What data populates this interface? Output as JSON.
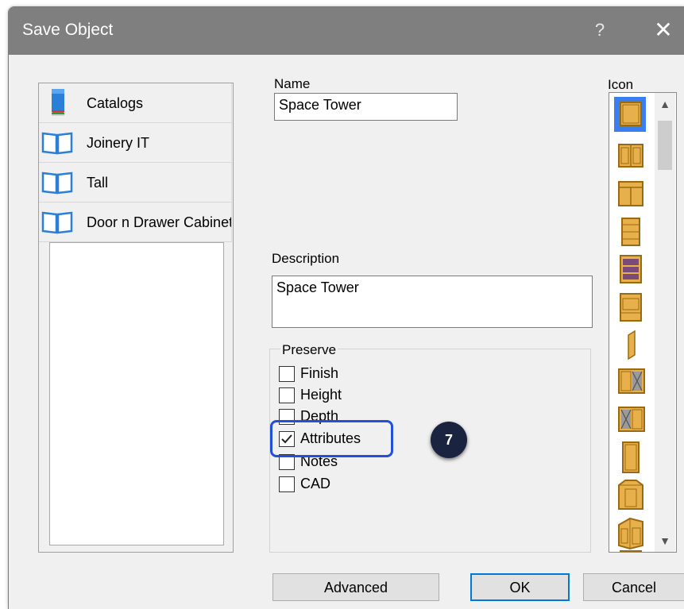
{
  "window": {
    "title": "Save Object",
    "help_label": "?",
    "close_label": "✕"
  },
  "catalog_tree": {
    "items": [
      {
        "label": "Catalogs",
        "icon": "catalog-book-icon"
      },
      {
        "label": "Joinery IT",
        "icon": "open-book-icon"
      },
      {
        "label": "Tall",
        "icon": "open-book-icon"
      },
      {
        "label": "Door n Drawer Cabinet",
        "icon": "open-book-icon"
      }
    ]
  },
  "form": {
    "name_label": "Name",
    "name_value": "Space Tower",
    "description_label": "Description",
    "description_value": "Space Tower",
    "preserve": {
      "legend": "Preserve",
      "options": [
        {
          "label": "Finish",
          "checked": false
        },
        {
          "label": "Height",
          "checked": false
        },
        {
          "label": "Depth",
          "checked": false
        },
        {
          "label": "Attributes",
          "checked": true
        },
        {
          "label": "Notes",
          "checked": false
        },
        {
          "label": "CAD",
          "checked": false
        }
      ]
    }
  },
  "icon_panel": {
    "label": "Icon",
    "icons": [
      "single-door-base-icon",
      "double-door-base-icon",
      "door-drawer-base-icon",
      "drawer-stack-icon",
      "open-shelf-icon",
      "oven-housing-icon",
      "end-panel-icon",
      "glass-door-right-icon",
      "glass-door-left-icon",
      "tall-door-icon",
      "angled-corner-icon",
      "corner-base-icon",
      "drawer-base-partial-icon"
    ],
    "selected_index": 0
  },
  "annotation": {
    "step": "7",
    "color": "#2350d8"
  },
  "buttons": {
    "advanced": "Advanced",
    "ok": "OK",
    "cancel": "Cancel"
  },
  "colors": {
    "titlebar": "#7f7f7f",
    "wood": "#e8b04a",
    "wood_edge": "#9a6a12",
    "selection": "#3a7ff0"
  }
}
